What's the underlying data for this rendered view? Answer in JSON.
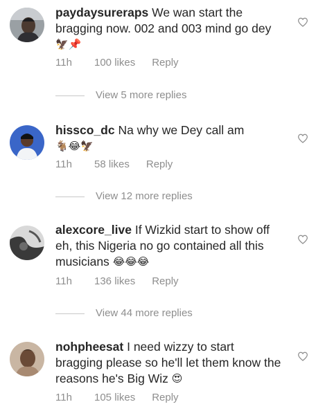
{
  "comments": [
    {
      "username": "paydaysureraps",
      "text": "We wan start the bragging now. 002 and 003 mind go dey",
      "emojis": "🦅📌",
      "time": "11h",
      "likes": "100 likes",
      "reply": "Reply"
    },
    {
      "username": "hissco_dc",
      "text": "Na why we Dey call am",
      "emojis": "🐐😂🦅",
      "time": "11h",
      "likes": "58 likes",
      "reply": "Reply"
    },
    {
      "username": "alexcore_live",
      "text": "If Wizkid start to show off eh, this Nigeria no go contained all this musicians",
      "emojis": "😂😂😂",
      "time": "11h",
      "likes": "136 likes",
      "reply": "Reply"
    },
    {
      "username": "nohpheesat",
      "text": "I need wizzy to start bragging please so he'll let them know the reasons he's Big Wiz",
      "emojis": "😍",
      "time": "11h",
      "likes": "105 likes",
      "reply": "Reply"
    }
  ],
  "view_more": [
    "View 5 more replies",
    "View 12 more replies",
    "View 44 more replies"
  ],
  "colors": {
    "text": "#262626",
    "meta": "#8e8e8e",
    "divider": "#c7c7c7"
  },
  "icons": {
    "like": "heart-outline-icon"
  }
}
